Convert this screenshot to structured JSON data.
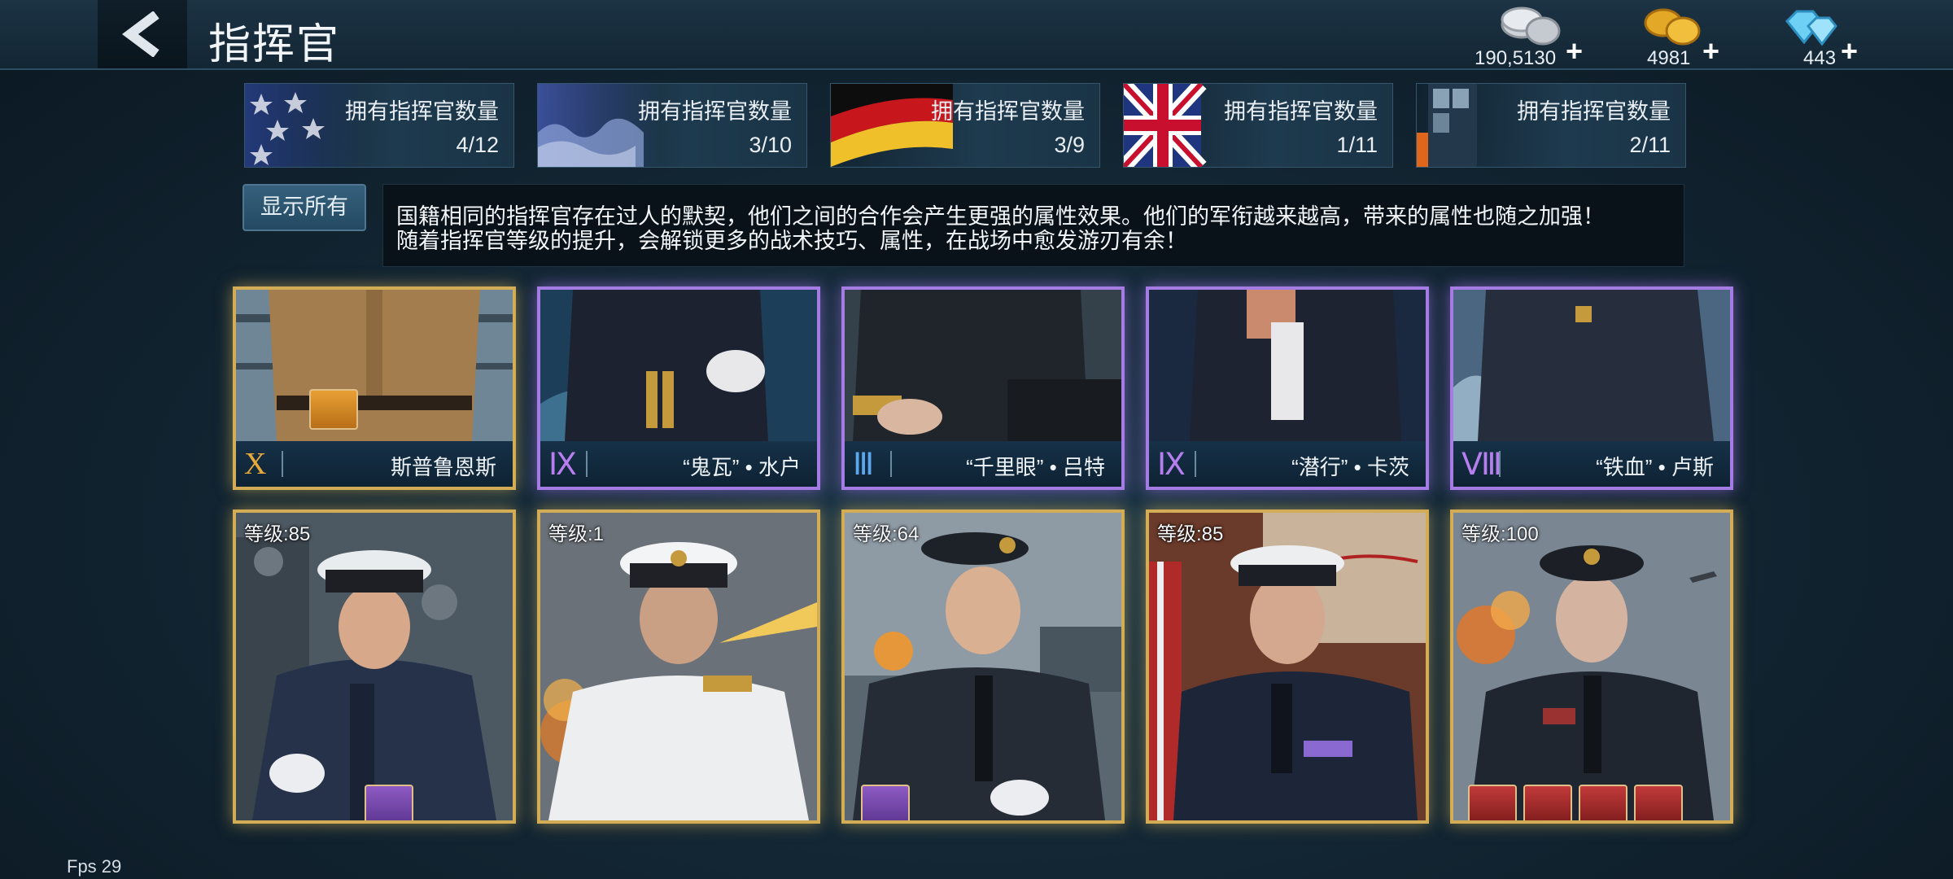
{
  "header": {
    "title": "指挥官",
    "back_icon": "chevron-left-icon",
    "currencies": [
      {
        "name": "silver",
        "icon": "silver-coins-icon",
        "amount": "190,5130",
        "plus": "+"
      },
      {
        "name": "gold",
        "icon": "gold-coins-icon",
        "amount": "4981",
        "plus": "+"
      },
      {
        "name": "diamond",
        "icon": "diamond-icon",
        "amount": "443",
        "plus": "+"
      }
    ]
  },
  "nations": [
    {
      "flag": "usa-flag",
      "label": "拥有指挥官数量",
      "count": "4/12"
    },
    {
      "flag": "japan-flag",
      "label": "拥有指挥官数量",
      "count": "3/10"
    },
    {
      "flag": "germany-flag",
      "label": "拥有指挥官数量",
      "count": "3/9"
    },
    {
      "flag": "uk-flag",
      "label": "拥有指挥官数量",
      "count": "1/11"
    },
    {
      "flag": "ussr-flag",
      "label": "拥有指挥官数量",
      "count": "2/11"
    }
  ],
  "filter": {
    "show_all": "显示所有"
  },
  "info": {
    "line1": "国籍相同的指挥官存在过人的默契，他们之间的合作会产生更强的属性效果。他们的军衔越来越高，带来的属性也随之加强！",
    "line2": "随着指挥官等级的提升，会解锁更多的战术技巧、属性，在战场中愈发游刃有余！"
  },
  "top_cards": [
    {
      "rank": "X",
      "rank_color": "#e6a93a",
      "name": "斯普鲁恩斯",
      "frame": "gold"
    },
    {
      "rank": "Ⅸ",
      "rank_color": "#b77ef0",
      "name": "“鬼瓦” • 水户",
      "frame": "purple"
    },
    {
      "rank": "Ⅲ",
      "rank_color": "#5aa8f0",
      "name": "“千里眼” • 吕特",
      "frame": "purple"
    },
    {
      "rank": "Ⅸ",
      "rank_color": "#b77ef0",
      "name": "“潜行” • 卡茨",
      "frame": "purple"
    },
    {
      "rank": "Ⅷ",
      "rank_color": "#b77ef0",
      "name": "“铁血” • 卢斯",
      "frame": "purple"
    }
  ],
  "bottom_cards": [
    {
      "level": "等级:85"
    },
    {
      "level": "等级:1"
    },
    {
      "level": "等级:64"
    },
    {
      "level": "等级:85"
    },
    {
      "level": "等级:100"
    }
  ],
  "fps": "Fps 29"
}
